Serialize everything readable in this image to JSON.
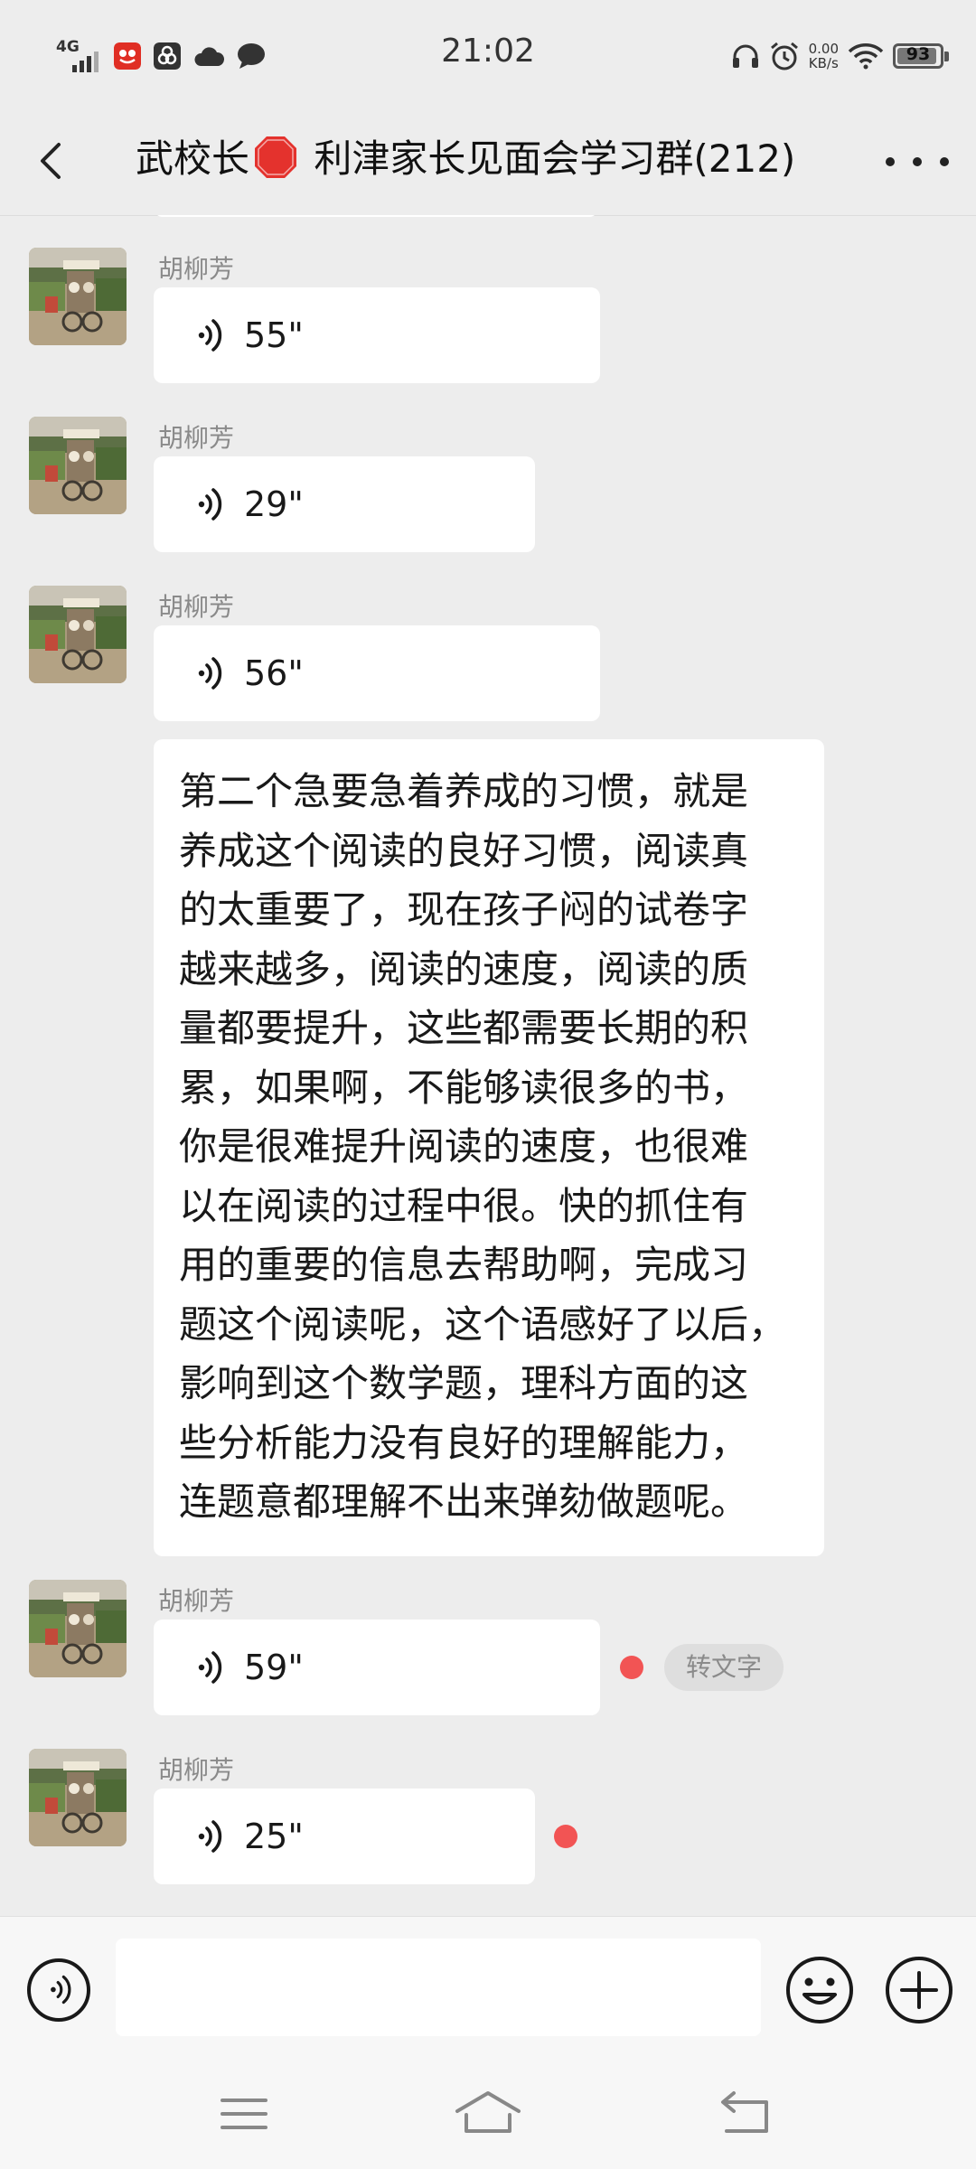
{
  "status_bar": {
    "network": "4G",
    "time": "21:02",
    "speed_value": "0.00",
    "speed_unit": "KB/s",
    "battery": "93",
    "battery_level": 0.93
  },
  "header": {
    "title_prefix": "武校长",
    "title_main": "利津家长见面会学习群(212)"
  },
  "messages": [
    {
      "sender": "胡柳芳",
      "type": "voice",
      "duration": "55\""
    },
    {
      "sender": "胡柳芳",
      "type": "voice",
      "duration": "29\""
    },
    {
      "sender": "胡柳芳",
      "type": "voice",
      "duration": "56\""
    },
    {
      "type": "text",
      "lines": [
        "第二个急要急着养成的习惯，就是",
        "养成这个阅读的良好习惯，阅读真",
        "的太重要了，现在孩子闷的试卷字",
        "越来越多，阅读的速度，阅读的质",
        "量都要提升，这些都需要长期的积",
        "累，如果啊，不能够读很多的书，",
        "你是很难提升阅读的速度，也很难",
        "以在阅读的过程中很。快的抓住有",
        "用的重要的信息去帮助啊，完成习",
        "题这个阅读呢，这个语感好了以后，",
        "影响到这个数学题，理科方面的这",
        "些分析能力没有良好的理解能力，",
        "连题意都理解不出来弹劾做题呢。"
      ]
    },
    {
      "sender": "胡柳芳",
      "type": "voice",
      "duration": "59\"",
      "unread": true,
      "action": "转文字"
    },
    {
      "sender": "胡柳芳",
      "type": "voice",
      "duration": "25\"",
      "unread": true
    }
  ],
  "input": {
    "value": "",
    "placeholder": ""
  },
  "colors": {
    "background": "#ededed",
    "bubble": "#ffffff",
    "unread_dot": "#f25454",
    "sender": "#8a8a8a"
  }
}
